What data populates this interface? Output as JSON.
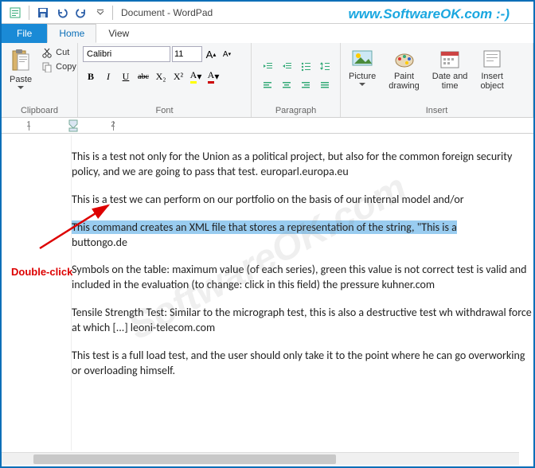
{
  "window": {
    "title": "Document - WordPad"
  },
  "watermark_url": "www.SoftwareOK.com :-)",
  "watermark_big": "SoftwareOK.com",
  "annotation": "Double-click",
  "tabs": {
    "file": "File",
    "home": "Home",
    "view": "View"
  },
  "ribbon": {
    "clipboard": {
      "paste": "Paste",
      "cut": "Cut",
      "copy": "Copy",
      "label": "Clipboard"
    },
    "font": {
      "family": "Calibri",
      "size": "11",
      "bold": "B",
      "italic": "I",
      "underline": "U",
      "strike": "abc",
      "sub": "X₂",
      "sup": "X²",
      "color": "A",
      "highlight": "A",
      "grow": "A",
      "shrink": "A",
      "label": "Font"
    },
    "paragraph": {
      "label": "Paragraph"
    },
    "insert": {
      "picture": "Picture",
      "paint": "Paint\ndrawing",
      "datetime": "Date and\ntime",
      "object": "Insert\nobject",
      "label": "Insert"
    }
  },
  "ruler": {
    "marks": [
      "1",
      "2"
    ]
  },
  "document": {
    "p1": "This is a test not only for the Union as a political project, but also for the common foreign security policy, and we are going to pass that test. europarl.europa.eu",
    "p2": "This is a test we can perform on our portfolio on the basis of our internal model and/or",
    "p3_hl": "This command creates an XML file that stores a representation of the string, \"This is a",
    "p3_rest": "buttongo.de",
    "p4": "Symbols on the table: maximum value (of each series), green this value is not correct test is valid and included in the evaluation (to change: click in this field) the pressure kuhner.com",
    "p5": "Tensile Strength Test: Similar to the micrograph test, this is also a destructive test wh withdrawal force at which [...] leoni-telecom.com",
    "p6": "This test is a full load test, and the user should only take it to the point where he can go overworking or overloading himself."
  }
}
